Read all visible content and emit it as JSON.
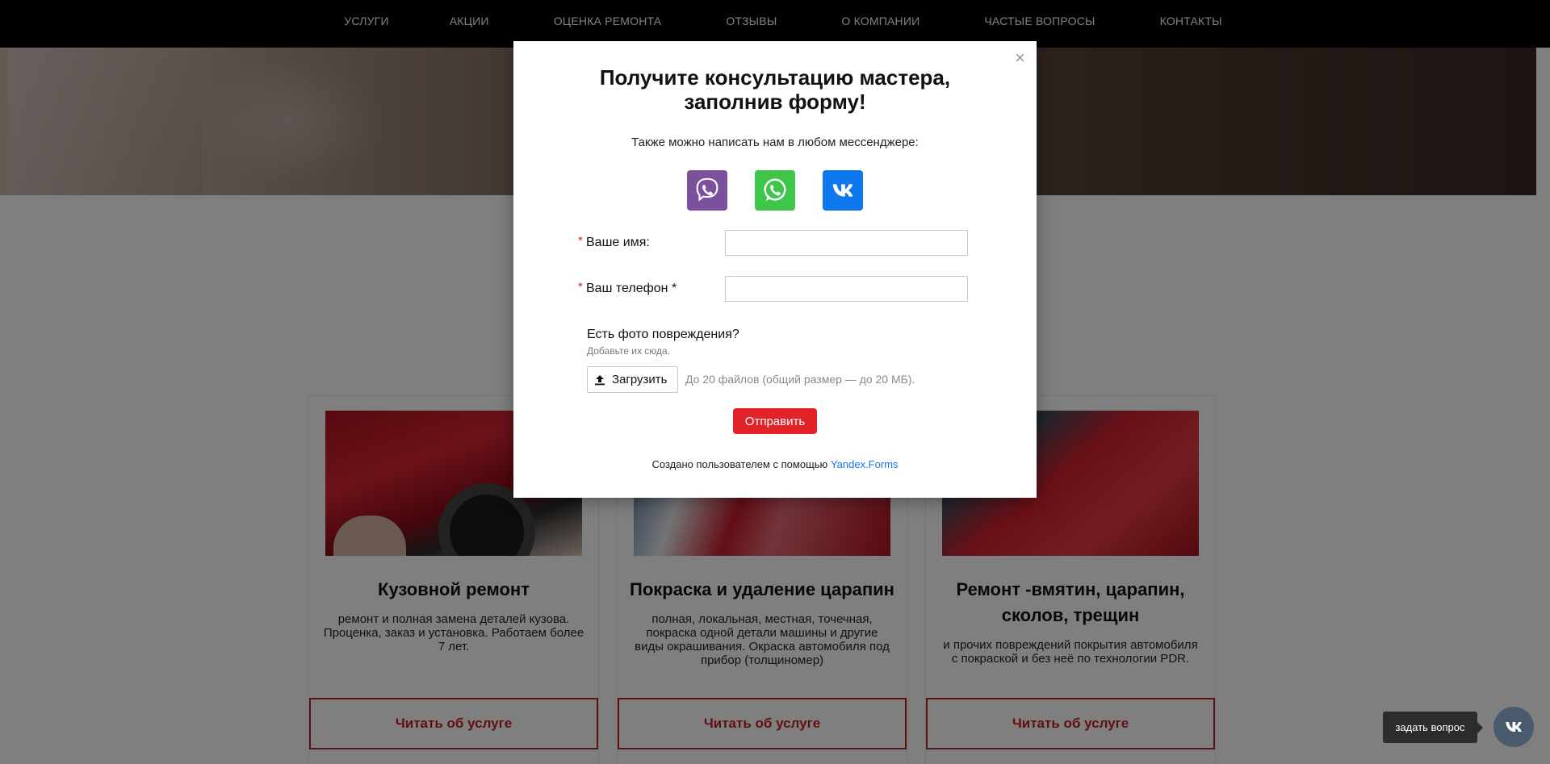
{
  "nav": {
    "items": [
      "УСЛУГИ",
      "АКЦИИ",
      "ОЦЕНКА РЕМОНТА",
      "ОТЗЫВЫ",
      "О КОМПАНИИ",
      "ЧАСТЫЕ ВОПРОСЫ",
      "КОНТАКТЫ"
    ]
  },
  "cards": [
    {
      "title": "Кузовной ремонт",
      "description": "ремонт и полная замена деталей кузова. Проценка, заказ и установка. Работаем более 7 лет.",
      "button": "Читать об услуге",
      "icon": "car-body-repair-photo"
    },
    {
      "title": "Покраска и удаление царапин",
      "description": "полная, локальная, местная, точечная, покраска одной детали машины и другие виды окрашивания. Окраска автомобиля под прибор (толщиномер)",
      "button": "Читать об услуге",
      "icon": "car-painting-photo"
    },
    {
      "title": "Ремонт -вмятин, царапин, сколов, трещин",
      "description": "и прочих повреждений покрытия автомобиля с покраской и без неё по технологии PDR.",
      "button": "Читать об услуге",
      "icon": "dent-repair-photo"
    }
  ],
  "modal": {
    "close": "×",
    "title_line1": "Получите консультацию мастера,",
    "title_line2": "заполнив форму!",
    "subtitle": "Также можно написать нам в любом мессенджере:",
    "messengers": [
      {
        "name": "viber-icon",
        "color": "#7b519d"
      },
      {
        "name": "whatsapp-icon",
        "color": "#3fc64a"
      },
      {
        "name": "vk-icon",
        "color": "#0d77ee"
      }
    ],
    "fields": {
      "name_label": "Ваше имя:",
      "name_value": "",
      "phone_label": "Ваш телефон *",
      "phone_value": "",
      "required_mark": "*"
    },
    "photo_question": "Есть фото повреждения?",
    "photo_hint": "Добавьте их сюда.",
    "upload_button": "Загрузить",
    "upload_note": "До 20 файлов (общий размер — до 20 МБ).",
    "submit_button": "Отправить",
    "credit_text": "Создано пользователем с помощью",
    "credit_link": "Yandex.Forms",
    "accent_color": "#e3232a"
  },
  "widget": {
    "ask_label": "задать вопрос",
    "fab_icon": "vk-icon"
  }
}
